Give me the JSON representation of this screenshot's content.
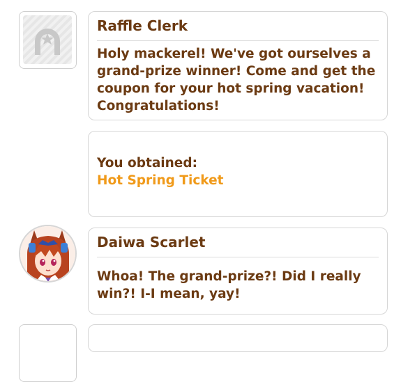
{
  "dialogues": [
    {
      "speaker": "Raffle Clerk",
      "text": "Holy mackerel! We've got ourselves a grand-prize winner! Come and get the coupon for your hot spring vacation! Congratulations!",
      "avatar": "placeholder-avatar-icon"
    },
    {
      "label": "You obtained:",
      "item": "Hot Spring Ticket"
    },
    {
      "speaker": "Daiwa Scarlet",
      "text": "Whoa! The grand-prize?! Did I really win?! I-I mean, yay!",
      "avatar": "daiwa-scarlet-portrait"
    }
  ],
  "colors": {
    "text": "#6b3a12",
    "highlight": "#f09a1a",
    "border": "#d6d6d6"
  }
}
